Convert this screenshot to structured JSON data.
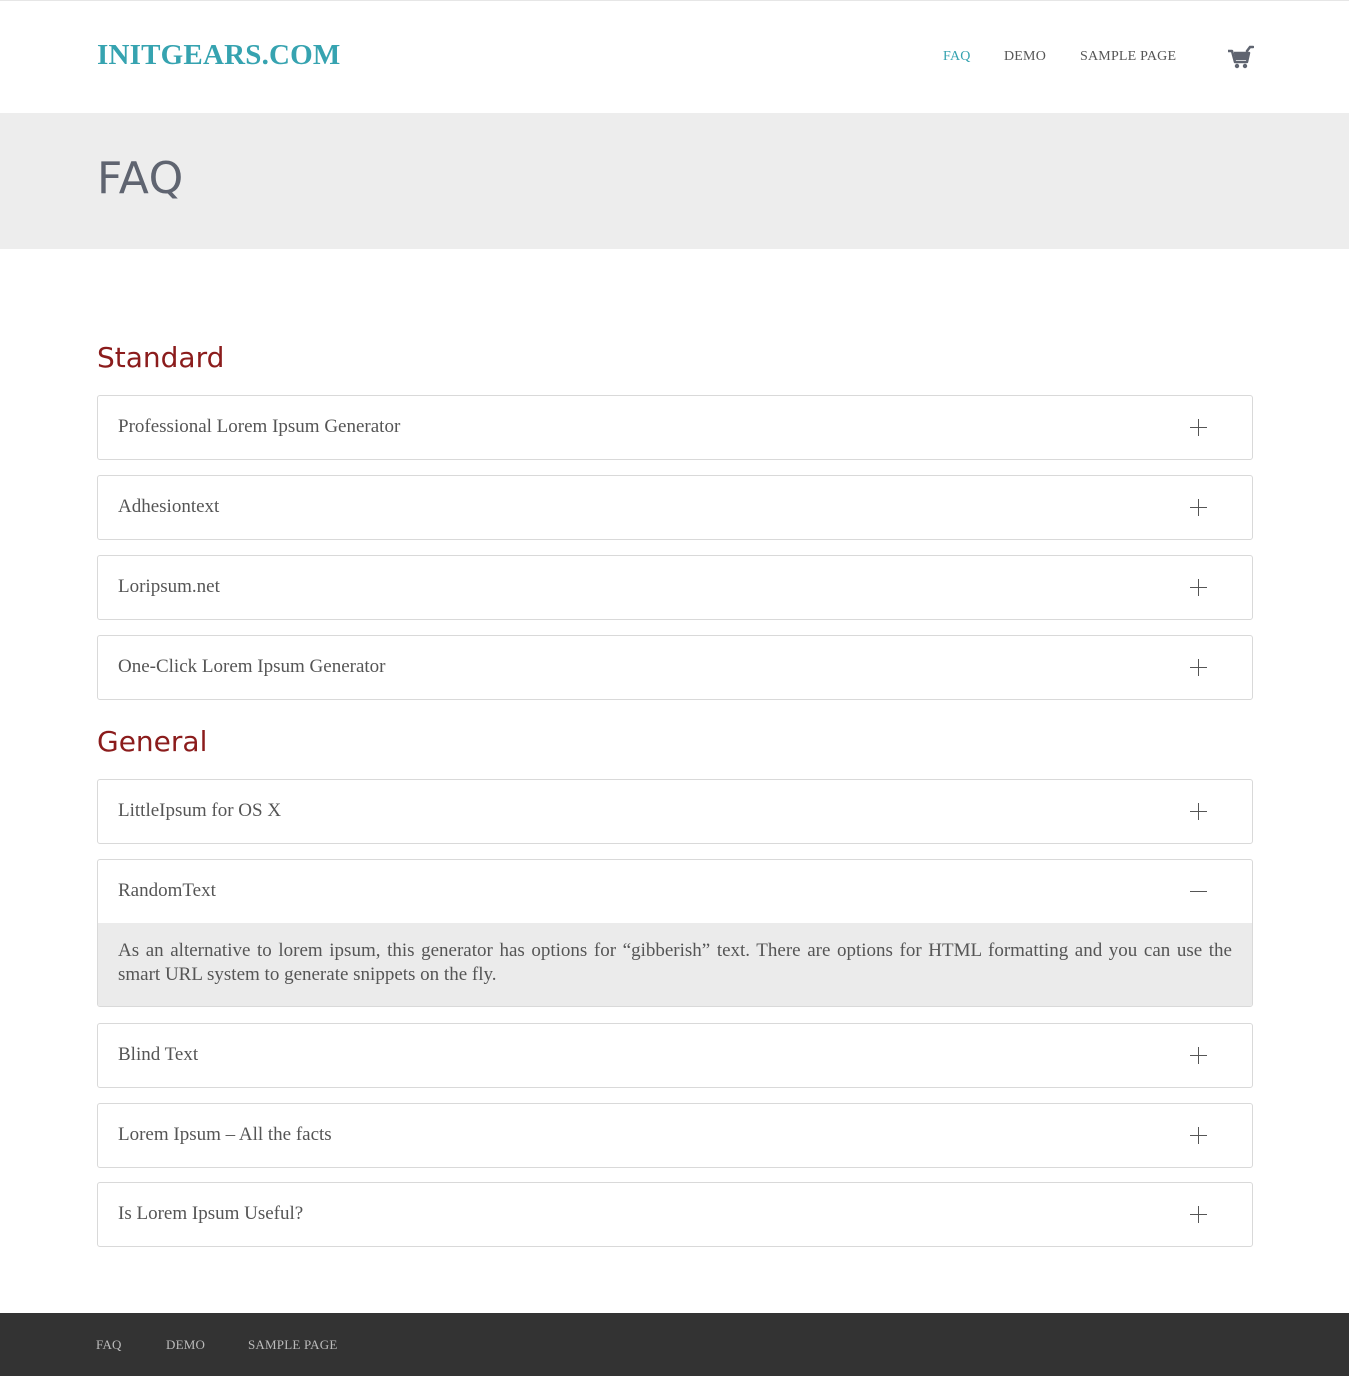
{
  "site": {
    "logo": "INITGEARS.COM",
    "nav": [
      {
        "label": "FAQ",
        "active": true
      },
      {
        "label": "DEMO",
        "active": false
      },
      {
        "label": "SAMPLE PAGE",
        "active": false
      }
    ],
    "cart_icon": "cart-icon"
  },
  "banner": {
    "title": "FAQ"
  },
  "sections": [
    {
      "title": "Standard",
      "items": [
        {
          "question": "Professional Lorem Ipsum Generator",
          "expanded": false
        },
        {
          "question": "Adhesiontext",
          "expanded": false
        },
        {
          "question": "Loripsum.net",
          "expanded": false
        },
        {
          "question": "One-Click Lorem Ipsum Generator",
          "expanded": false
        }
      ]
    },
    {
      "title": "General",
      "items": [
        {
          "question": "LittleIpsum for OS X",
          "expanded": false
        },
        {
          "question": "RandomText",
          "expanded": true,
          "answer": "As an alternative to lorem ipsum, this generator has options for “gibberish” text. There are options for HTML formatting and you can use the smart URL system to generate snippets on the fly."
        },
        {
          "question": "Blind Text",
          "expanded": false
        },
        {
          "question": "Lorem Ipsum – All the facts",
          "expanded": false
        },
        {
          "question": "Is Lorem Ipsum Useful?",
          "expanded": false
        }
      ]
    }
  ],
  "footer": {
    "links": [
      "FAQ",
      "DEMO",
      "SAMPLE PAGE"
    ]
  },
  "colors": {
    "brand": "#36a3b0",
    "nav_text": "#555555",
    "nav_active": "#36a3b0",
    "section_title": "#8b1c1c",
    "banner_title": "#5f6470",
    "footer_bg": "#333333",
    "footer_text": "#bbbbbb"
  },
  "icons": {
    "collapsed": "plus-icon",
    "expanded": "minus-icon"
  }
}
